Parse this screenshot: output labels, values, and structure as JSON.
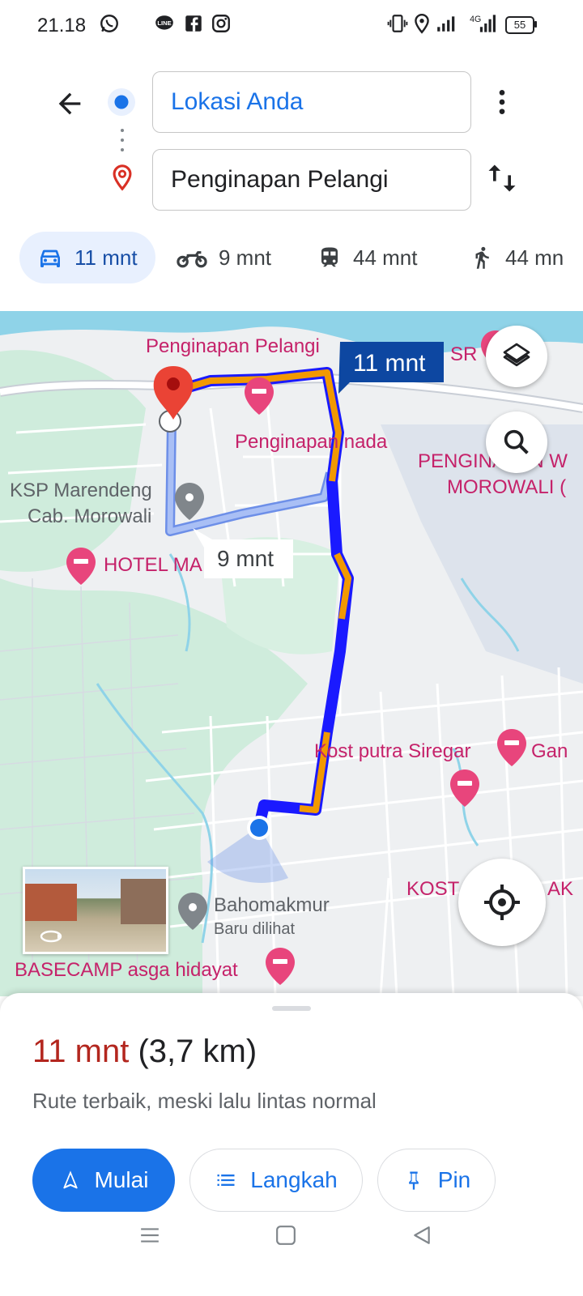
{
  "status_bar": {
    "time": "21.18",
    "battery": "55",
    "network": "4G"
  },
  "search": {
    "origin": "Lokasi Anda",
    "destination": "Penginapan Pelangi"
  },
  "modes": [
    {
      "icon": "car-icon",
      "label": "11 mnt",
      "active": true
    },
    {
      "icon": "motorcycle-icon",
      "label": "9 mnt"
    },
    {
      "icon": "transit-icon",
      "label": "44 mnt"
    },
    {
      "icon": "walk-icon",
      "label": "44 mn"
    }
  ],
  "map": {
    "labels": {
      "pelangi": "Penginapan Pelangi",
      "nada": "Penginapan nada",
      "sr": "SR",
      "pengin": "PENGINAPAN W",
      "morowali": "MOROWALI (",
      "ksp1": "KSP Marendeng",
      "ksp2": "Cab. Morowali",
      "hotel": "HOTEL MA",
      "kost": "Kost putra Siregar",
      "gan": "Gan",
      "kost2": "KOST",
      "kost3": "AK",
      "bahomakmur": "Bahomakmur",
      "baru": "Baru dilihat",
      "basecamp": "BASECAMP asga hidayat"
    },
    "route_bubble": "11 mnt",
    "alt_bubble": "9 mnt"
  },
  "sheet": {
    "time": "11 mnt",
    "distance": "(3,7 km)",
    "subtitle": "Rute terbaik, meski lalu lintas normal",
    "buttons": {
      "start": "Mulai",
      "steps": "Langkah",
      "pin": "Pin"
    }
  },
  "colors": {
    "accent": "#1a73e8",
    "route_traffic": "#f29900",
    "route_main": "#1a1aff",
    "eta": "#b3261e"
  }
}
